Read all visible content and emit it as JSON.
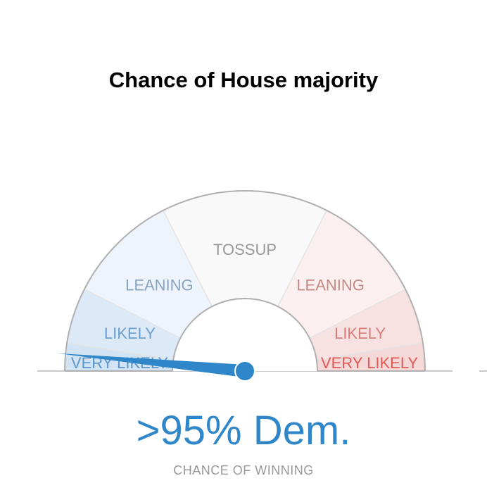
{
  "title": "Chance of House majority",
  "result_text": ">95% Dem.",
  "subtitle": "CHANCE OF WINNING",
  "chart_data": {
    "type": "gauge",
    "title": "Chance of House majority",
    "segments": [
      {
        "label": "VERY LIKELY",
        "side": "Dem.",
        "range": [
          95,
          100
        ],
        "fill": "#d2e4f3",
        "text": "#5a96cc"
      },
      {
        "label": "LIKELY",
        "side": "Dem.",
        "range": [
          85,
          95
        ],
        "fill": "#dce9f6",
        "text": "#6b9fd0"
      },
      {
        "label": "LEANING",
        "side": "Dem.",
        "range": [
          65,
          85
        ],
        "fill": "#eef4fb",
        "text": "#8aa4bd"
      },
      {
        "label": "TOSSUP",
        "side": "",
        "range": [
          35,
          65
        ],
        "fill": "#f9f9f9",
        "text": "#999999"
      },
      {
        "label": "LEANING",
        "side": "Rep.",
        "range": [
          15,
          35
        ],
        "fill": "#fbf0ef",
        "text": "#c48a88"
      },
      {
        "label": "LIKELY",
        "side": "Rep.",
        "range": [
          5,
          15
        ],
        "fill": "#f7e2e1",
        "text": "#d47e7c"
      },
      {
        "label": "VERY LIKELY",
        "side": "Rep.",
        "range": [
          0,
          5
        ],
        "fill": "#f5d8d8",
        "text": "#e05a58"
      }
    ],
    "needle_value": 97,
    "needle_party": "Dem.",
    "value_text": ">95% Dem.",
    "caption": "CHANCE OF WINNING"
  },
  "colors": {
    "dem": "#2f86c8",
    "needle": "#2f86c8",
    "outline": "#b0b0b0",
    "divider": "#e4e4e4",
    "baseline": "#b8b8b8"
  }
}
